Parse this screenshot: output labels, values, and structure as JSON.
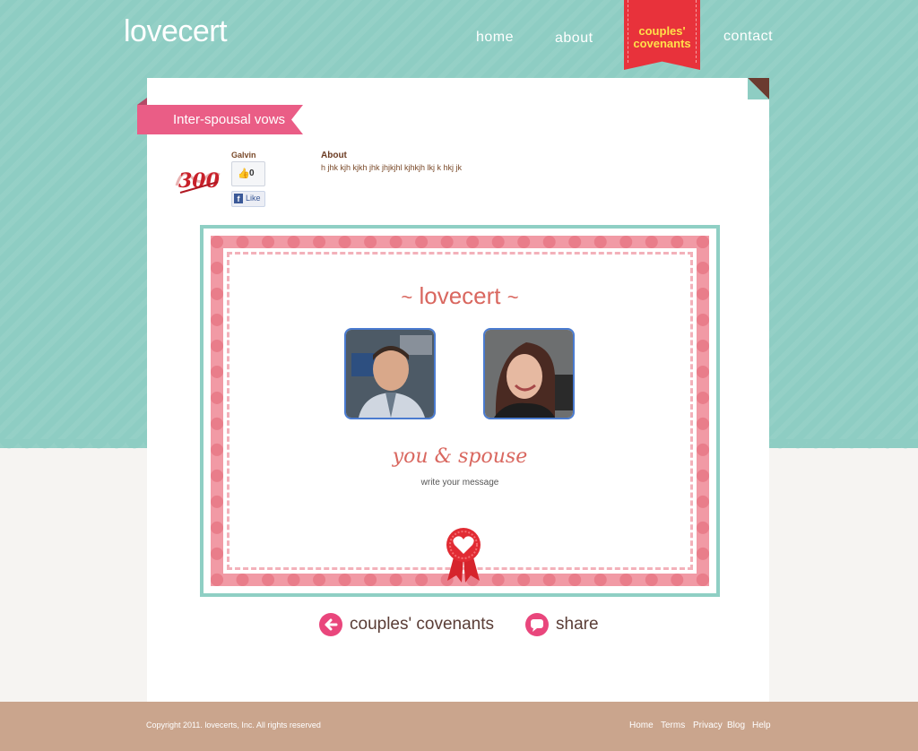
{
  "header": {
    "logo": "lovecert",
    "nav": [
      {
        "label": "home"
      },
      {
        "label": "about"
      },
      {
        "label_line1": "couples'",
        "label_line2": "covenants",
        "active": true
      },
      {
        "label": "contact"
      }
    ]
  },
  "page": {
    "title": "Inter-spousal vows",
    "user": {
      "name": "Galvin",
      "avatar_text": "300"
    },
    "like_count": "0",
    "fb_like_label": "Like",
    "about": {
      "label": "About",
      "text": "h jhk kjh kjkh jhk jhjkjhl kjhkjh lkj k hkj jk"
    }
  },
  "certificate": {
    "logo": "lovecert",
    "names": "you & spouse",
    "message": "write your message",
    "photos": [
      {
        "name": "partner-1-photo"
      },
      {
        "name": "partner-2-photo"
      }
    ]
  },
  "actions": {
    "back_label": "couples' covenants",
    "share_label": "share"
  },
  "footer": {
    "copyright": "Copyright 2011. lovecerts, Inc. All rights reserved",
    "links": [
      "Home",
      "Terms",
      "Privacy",
      "Blog",
      "Help"
    ]
  },
  "colors": {
    "teal": "#8ecdc3",
    "ribbon_red": "#e8323b",
    "ribbon_text": "#ffe04a",
    "pink": "#ea5d86",
    "cert_pink": "#f19aa5",
    "footer_tan": "#caa58d"
  }
}
